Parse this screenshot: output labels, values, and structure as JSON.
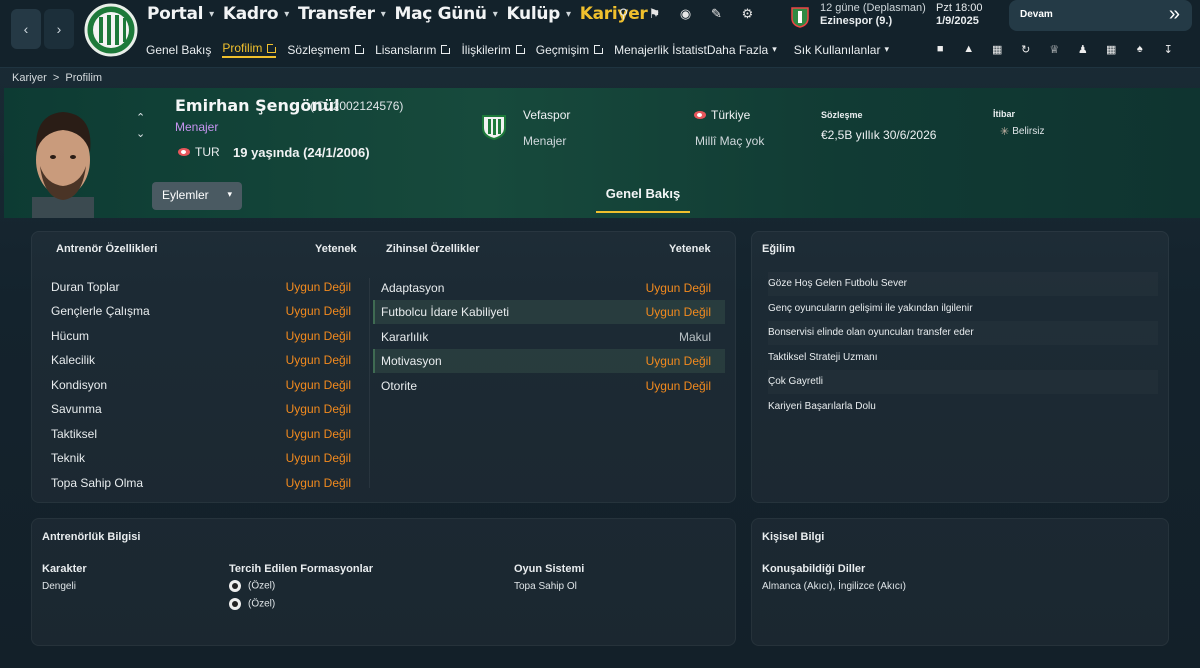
{
  "nav": {
    "back": "‹",
    "forward": "›",
    "items": [
      {
        "label": "Portal",
        "active": false
      },
      {
        "label": "Kadro",
        "active": false
      },
      {
        "label": "Transfer",
        "active": false
      },
      {
        "label": "Maç Günü",
        "active": false
      },
      {
        "label": "Kulüp",
        "active": false
      },
      {
        "label": "Kariyer",
        "active": true
      }
    ],
    "chevron": "⌄",
    "tools": [
      "search-icon",
      "bookmark-icon",
      "globe-icon",
      "pen-icon",
      "gear-icon"
    ]
  },
  "match": {
    "days": "12 güne (Deplasman)",
    "opponent": "Ezinespor (9.)",
    "day": "Pzt",
    "time": "18:00",
    "date": "1/9/2025"
  },
  "devam": {
    "label": "Devam",
    "icon": "»"
  },
  "subnav": {
    "items": [
      {
        "label": "Genel Bakış",
        "ext": false,
        "active": false
      },
      {
        "label": "Profilim",
        "ext": true,
        "active": true
      },
      {
        "label": "Sözleşmem",
        "ext": true,
        "active": false
      },
      {
        "label": "Lisanslarım",
        "ext": true,
        "active": false
      },
      {
        "label": "İlişkilerim",
        "ext": true,
        "active": false
      },
      {
        "label": "Geçmişim",
        "ext": true,
        "active": false
      },
      {
        "label": "Menajerlik İstatist",
        "ext": false,
        "active": false
      },
      {
        "label": "Daha Fazla",
        "ext": false,
        "active": false
      }
    ],
    "shortcuts": "Sık Kullanılanlar",
    "icons": [
      "chat-icon",
      "shirt-icon",
      "document-icon",
      "refresh-icon",
      "trophy-icon",
      "people-icon",
      "calendar-icon",
      "group-icon",
      "download-icon"
    ]
  },
  "breadcrumb": {
    "root": "Kariyer",
    "sep": ">",
    "current": "Profilim"
  },
  "profile": {
    "name": "Emirhan Şengönül",
    "id": "(ID: 2002124576)",
    "role": "Menajer",
    "nationality": "TUR",
    "age": "19 yaşında (24/1/2006)",
    "actions": "Eylemler",
    "club": "Vefaspor",
    "club_role": "Menajer",
    "country": "Türkiye",
    "caps": "Millî Maç yok",
    "contract_label": "Sözleşme",
    "contract": "€2,5B yıllık 30/6/2026",
    "reputation_label": "İtibar",
    "reputation": "Belirsiz",
    "tab": "Genel Bakış"
  },
  "coach_attrs": {
    "title": "Antrenör Özellikleri",
    "col": "Yetenek",
    "rows": [
      {
        "name": "Duran Toplar",
        "value": "Uygun Değil"
      },
      {
        "name": "Gençlerle Çalışma",
        "value": "Uygun Değil"
      },
      {
        "name": "Hücum",
        "value": "Uygun Değil"
      },
      {
        "name": "Kalecilik",
        "value": "Uygun Değil"
      },
      {
        "name": "Kondisyon",
        "value": "Uygun Değil"
      },
      {
        "name": "Savunma",
        "value": "Uygun Değil"
      },
      {
        "name": "Taktiksel",
        "value": "Uygun Değil"
      },
      {
        "name": "Teknik",
        "value": "Uygun Değil"
      },
      {
        "name": "Topa Sahip Olma",
        "value": "Uygun Değil"
      }
    ]
  },
  "mental_attrs": {
    "title": "Zihinsel Özellikler",
    "col": "Yetenek",
    "rows": [
      {
        "name": "Adaptasyon",
        "value": "Uygun Değil"
      },
      {
        "name": "Futbolcu İdare Kabiliyeti",
        "value": "Uygun Değil"
      },
      {
        "name": "Kararlılık",
        "value": "Makul"
      },
      {
        "name": "Motivasyon",
        "value": "Uygun Değil"
      },
      {
        "name": "Otorite",
        "value": "Uygun Değil"
      }
    ]
  },
  "tendency": {
    "title": "Eğilim",
    "items": [
      "Göze Hoş Gelen Futbolu Sever",
      "Genç oyuncuların gelişimi ile yakından ilgilenir",
      "Bonservisi elinde olan oyuncuları transfer eder",
      "Taktiksel Strateji Uzmanı",
      "Çok Gayretli",
      "Kariyeri Başarılarla Dolu"
    ]
  },
  "coaching_info": {
    "title": "Antrenörlük Bilgisi",
    "character_label": "Karakter",
    "character": "Dengeli",
    "formations_label": "Tercih Edilen Formasyonlar",
    "formations": [
      "(Özel)",
      "(Özel)"
    ],
    "system_label": "Oyun Sistemi",
    "system": "Topa Sahip Ol"
  },
  "personal_info": {
    "title": "Kişisel Bilgi",
    "languages_label": "Konuşabildiği Diller",
    "languages": "Almanca (Akıcı), İngilizce (Akıcı)"
  },
  "colors": {
    "accent": "#f0c02d",
    "warning": "#f28a1e",
    "role": "#c794f0",
    "header": "#174a3c"
  }
}
